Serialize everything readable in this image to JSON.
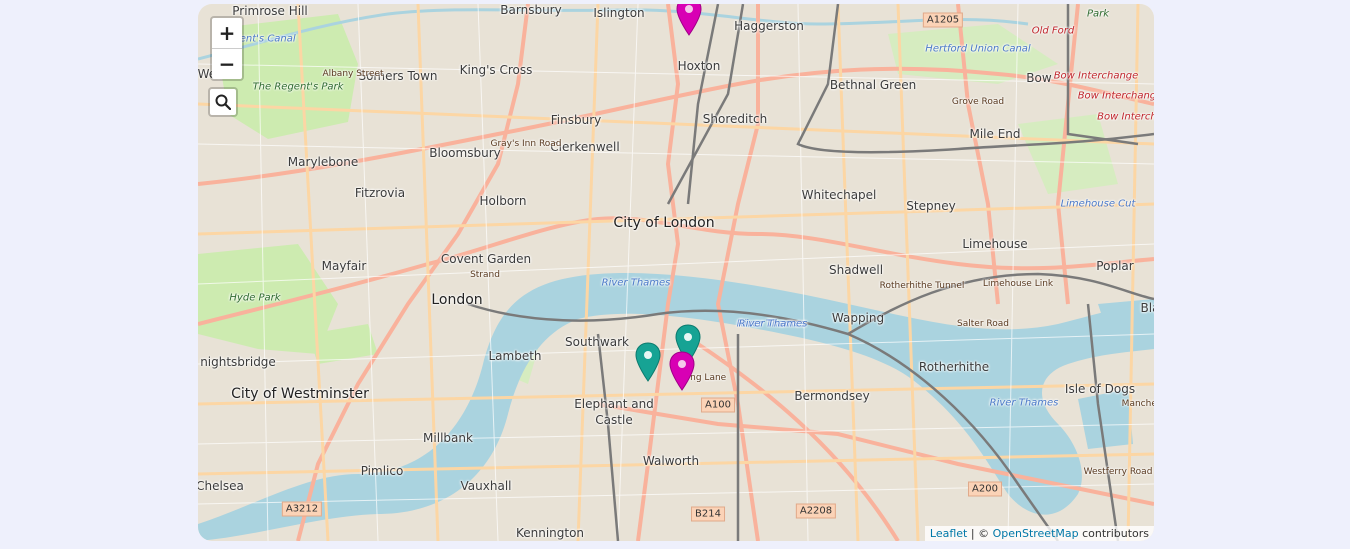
{
  "map": {
    "colors": {
      "water": "#aad3df",
      "park": "#cdebb0",
      "major_road": "#f9b29c",
      "secondary_road": "#fcd6a4",
      "rail": "#7a7a7a",
      "urban": "#e6e0d4",
      "teal_marker": "#16a394",
      "magenta_marker": "#d800b4"
    },
    "places": [
      {
        "name": "Barnsbury",
        "style": "normal"
      },
      {
        "name": "Islington",
        "style": "normal"
      },
      {
        "name": "Haggerston",
        "style": "normal"
      },
      {
        "name": "Primrose Hill",
        "style": "normal"
      },
      {
        "name": "Somers Town",
        "style": "normal"
      },
      {
        "name": "King's Cross",
        "style": "normal"
      },
      {
        "name": "Hoxton",
        "style": "normal"
      },
      {
        "name": "Bethnal Green",
        "style": "normal"
      },
      {
        "name": "Bow",
        "style": "normal"
      },
      {
        "name": "Old Ford",
        "style": "red"
      },
      {
        "name": "The Regent's Park",
        "style": "park"
      },
      {
        "name": "Finsbury",
        "style": "normal"
      },
      {
        "name": "Shoreditch",
        "style": "normal"
      },
      {
        "name": "Mile End",
        "style": "normal"
      },
      {
        "name": "Marylebone",
        "style": "normal"
      },
      {
        "name": "Bloomsbury",
        "style": "normal"
      },
      {
        "name": "Clerkenwell",
        "style": "normal"
      },
      {
        "name": "Fitzrovia",
        "style": "normal"
      },
      {
        "name": "Whitechapel",
        "style": "normal"
      },
      {
        "name": "Stepney",
        "style": "normal"
      },
      {
        "name": "Holborn",
        "style": "normal"
      },
      {
        "name": "City of London",
        "style": "big"
      },
      {
        "name": "Limehouse",
        "style": "normal"
      },
      {
        "name": "Mayfair",
        "style": "normal"
      },
      {
        "name": "Covent Garden",
        "style": "normal"
      },
      {
        "name": "Shadwell",
        "style": "normal"
      },
      {
        "name": "Poplar",
        "style": "normal"
      },
      {
        "name": "Hyde Park",
        "style": "park"
      },
      {
        "name": "London",
        "style": "big"
      },
      {
        "name": "Wapping",
        "style": "normal"
      },
      {
        "name": "River Thames",
        "style": "water"
      },
      {
        "name": "Southwark",
        "style": "normal"
      },
      {
        "name": "Lambeth",
        "style": "normal"
      },
      {
        "name": "nightsbridge",
        "style": "normal"
      },
      {
        "name": "Rotherhithe",
        "style": "normal"
      },
      {
        "name": "City of Westminster",
        "style": "big"
      },
      {
        "name": "Bermondsey",
        "style": "normal"
      },
      {
        "name": "Isle of Dogs",
        "style": "normal"
      },
      {
        "name": "Elephant and",
        "style": "normal"
      },
      {
        "name": "Castle",
        "style": "normal"
      },
      {
        "name": "Millbank",
        "style": "normal"
      },
      {
        "name": "Walworth",
        "style": "normal"
      },
      {
        "name": "Pimlico",
        "style": "normal"
      },
      {
        "name": "Chelsea",
        "style": "normal"
      },
      {
        "name": "Vauxhall",
        "style": "normal"
      },
      {
        "name": "Kennington",
        "style": "normal"
      },
      {
        "name": "Bow Interchange",
        "style": "red"
      },
      {
        "name": "Bow Interchange",
        "style": "red"
      },
      {
        "name": "Bow Intercha",
        "style": "red"
      },
      {
        "name": "Bla",
        "style": "normal"
      },
      {
        "name": "Wes",
        "style": "normal"
      },
      {
        "name": "Long Lane",
        "style": "road"
      },
      {
        "name": "Gray's Inn Road",
        "style": "road"
      },
      {
        "name": "Albany Street",
        "style": "road"
      },
      {
        "name": "Strand",
        "style": "road"
      },
      {
        "name": "Grove Road",
        "style": "road"
      },
      {
        "name": "Rotherhithe Tunnel",
        "style": "road"
      },
      {
        "name": "Salter Road",
        "style": "road"
      },
      {
        "name": "Westferry Road",
        "style": "road"
      },
      {
        "name": "Limehouse Link",
        "style": "road"
      },
      {
        "name": "Hertford Union Canal",
        "style": "water"
      },
      {
        "name": "Regent's Canal",
        "style": "water"
      },
      {
        "name": "River Thames",
        "style": "water"
      },
      {
        "name": "River Thames",
        "style": "water"
      },
      {
        "name": "River Thames",
        "style": "water"
      },
      {
        "name": "Limehouse Cut",
        "style": "water"
      },
      {
        "name": "Manchester",
        "style": "road"
      },
      {
        "name": "Park",
        "style": "park"
      }
    ],
    "road_shields": [
      "A1205",
      "A100",
      "A3212",
      "B214",
      "A2208",
      "A200"
    ],
    "controls": {
      "zoom_in": "+",
      "zoom_out": "−"
    },
    "markers": [
      {
        "color": "magenta",
        "label": "magenta marker north"
      },
      {
        "color": "teal",
        "label": "teal marker"
      },
      {
        "color": "teal",
        "label": "teal marker"
      },
      {
        "color": "magenta",
        "label": "magenta marker"
      }
    ],
    "attribution": {
      "leaflet": "Leaflet",
      "separator": " | © ",
      "osm": "OpenStreetMap",
      "suffix": " contributors"
    }
  }
}
